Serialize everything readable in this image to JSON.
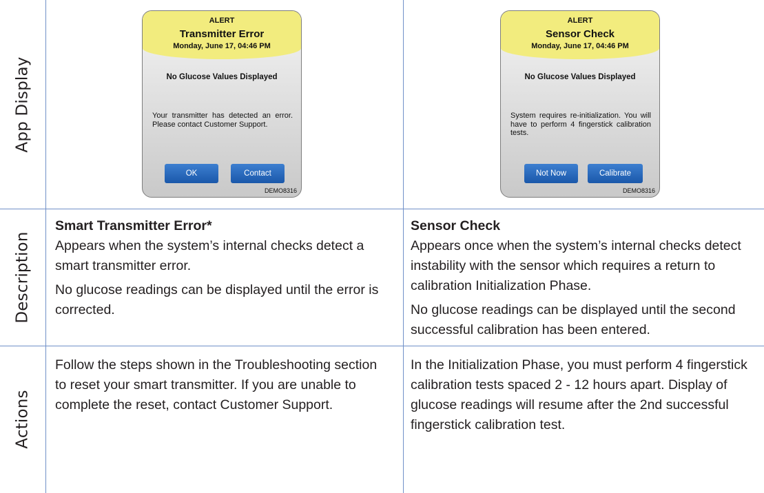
{
  "row_labels": {
    "app_display": "App Display",
    "description": "Description",
    "actions": "Actions"
  },
  "screens": [
    {
      "alert_label": "ALERT",
      "title": "Transmitter Error",
      "date": "Monday, June 17, 04:46 PM",
      "no_values": "No Glucose Values Displayed",
      "body": "Your transmitter has detected an error. Please contact Customer Support.",
      "button_left": "OK",
      "button_right": "Contact",
      "code": "DEMO8316"
    },
    {
      "alert_label": "ALERT",
      "title": "Sensor Check",
      "date": "Monday, June 17, 04:46 PM",
      "no_values": "No Glucose Values Displayed",
      "body": "System requires re-initialization. You will have to perform 4 fingerstick calibration tests.",
      "button_left": "Not Now",
      "button_right": "Calibrate",
      "code": "DEMO8316"
    }
  ],
  "descriptions": [
    {
      "title": "Smart Transmitter Error*",
      "para1": "Appears when the system’s internal checks detect a smart transmitter error.",
      "para2": "No glucose readings can be displayed until the error is corrected."
    },
    {
      "title": "Sensor Check",
      "para1": "Appears once when the system’s internal checks detect instability with the sensor which requires a return to calibration Initialization Phase.",
      "para2": "No glucose readings can be displayed until the second successful calibration has been entered."
    }
  ],
  "actions": [
    "Follow the steps shown in the Troubleshooting section to reset your smart transmitter. If you are unable to complete the reset, contact Customer Support.",
    "In the Initialization Phase, you must perform 4 fingerstick calibration tests spaced 2 - 12 hours apart. Display of glucose readings will resume after the 2nd successful fingerstick calibration test."
  ],
  "colors": {
    "grid_line": "#6f8fc8",
    "alert_header": "#f2ec7e",
    "button": "#1f63b8"
  }
}
